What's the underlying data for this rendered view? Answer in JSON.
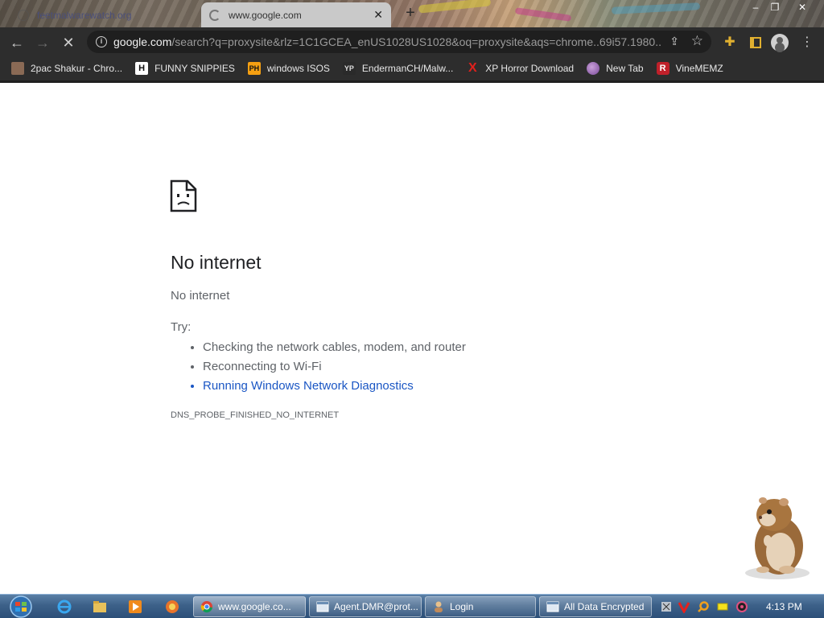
{
  "browser": {
    "tabs": [
      {
        "title": "feetmalwarewatch.org",
        "active": false
      },
      {
        "title": "www.google.com",
        "active": true,
        "loading": true
      }
    ],
    "new_tab_label": "+",
    "window_controls": {
      "minimize": "–",
      "maximize": "❐",
      "close": "✕"
    },
    "nav": {
      "back": "←",
      "forward": "→",
      "stop": "✕"
    },
    "address_bar": {
      "host": "google.com",
      "path": "/search?q=proxysite&rlz=1C1GCEA_enUS1028US1028&oq=proxysite&aqs=chrome..69i57.1980..."
    },
    "toolbar_icons": [
      "info-icon",
      "share-icon",
      "bookmark-star-icon",
      "extensions-icon",
      "side-panel-icon",
      "profile-icon",
      "menu-icon"
    ],
    "bookmarks": [
      {
        "label": "2pac Shakur - Chro...",
        "icon": ""
      },
      {
        "label": "FUNNY SNIPPIES",
        "icon": "H"
      },
      {
        "label": "windows ISOS",
        "icon": "PH"
      },
      {
        "label": "EndermanCH/Malw...",
        "icon": "YP"
      },
      {
        "label": "XP Horror Download",
        "icon": "X"
      },
      {
        "label": "New Tab",
        "icon": ""
      },
      {
        "label": "VineMEMZ",
        "icon": "R"
      }
    ]
  },
  "error_page": {
    "title": "No internet",
    "subtitle": "No internet",
    "try_label": "Try:",
    "suggestions": [
      "Checking the network cables, modem, and router",
      "Reconnecting to Wi-Fi",
      "Running Windows Network Diagnostics"
    ],
    "error_code": "DNS_PROBE_FINISHED_NO_INTERNET"
  },
  "taskbar": {
    "tasks": [
      {
        "label": "www.google.co..."
      },
      {
        "label": "Agent.DMR@prot..."
      },
      {
        "label": "Login"
      },
      {
        "label": "All Data Encrypted"
      }
    ],
    "clock": "4:13 PM"
  },
  "colors": {
    "chrome_dark": "#2d2d2d",
    "link_blue": "#1a56c4",
    "text_grey": "#5f6368",
    "taskbar_blue": "#3d6189"
  }
}
